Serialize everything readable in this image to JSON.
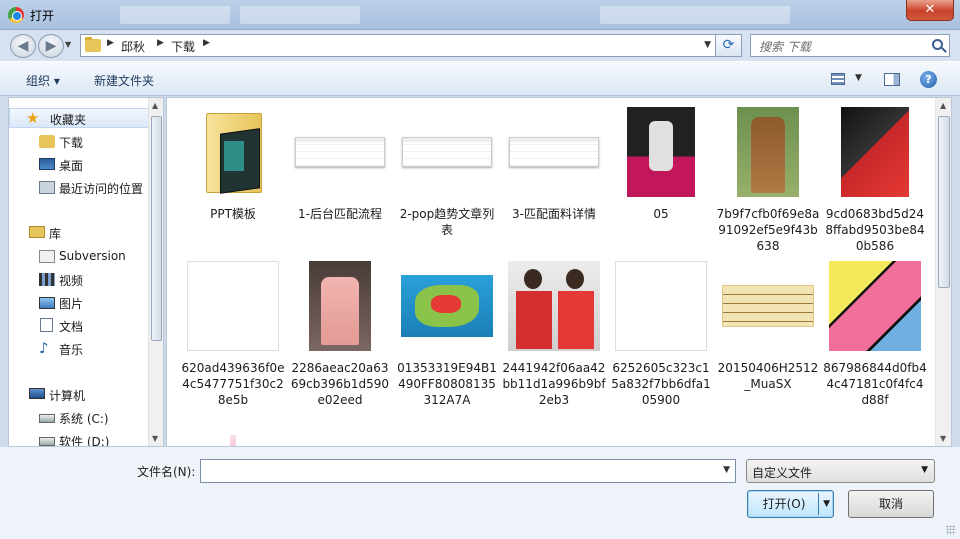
{
  "window": {
    "title": "打开",
    "close": "✕"
  },
  "address": {
    "crumbs": [
      "邱秋",
      "下载"
    ],
    "search_placeholder": "搜索 下载"
  },
  "toolbar": {
    "organize": "组织 ▾",
    "new_folder": "新建文件夹",
    "help": "?"
  },
  "nav": {
    "favorites": "收藏夹",
    "downloads": "下载",
    "desktop": "桌面",
    "recent": "最近访问的位置",
    "libraries": "库",
    "subversion": "Subversion",
    "videos": "视频",
    "pictures": "图片",
    "documents": "文档",
    "music": "音乐",
    "computer": "计算机",
    "drive_c": "系统 (C:)",
    "drive_d": "软件 (D:)"
  },
  "files": [
    {
      "name": "PPT模板",
      "kind": "folder"
    },
    {
      "name": "1-后台匹配流程",
      "kind": "screenshot"
    },
    {
      "name": "2-pop趋势文章列表",
      "kind": "screenshot"
    },
    {
      "name": "3-匹配面料详情",
      "kind": "screenshot"
    },
    {
      "name": "05",
      "kind": "photo-runway"
    },
    {
      "name": "7b9f7cfb0f69e8a91092ef5e9f43b638",
      "kind": "photo-fur"
    },
    {
      "name": "9cd0683bd5d248ffabd9503be840b586",
      "kind": "photo-red"
    },
    {
      "name": "620ad439636f0e4c5477751f30c28e5b",
      "kind": "pattern-birds"
    },
    {
      "name": "2286aeac20a6369cb396b1d590e02eed",
      "kind": "photo-pink-coat"
    },
    {
      "name": "01353319E94B1490FF80808135312A7A",
      "kind": "map"
    },
    {
      "name": "2441942f06aa42bb11d1a996b9bf2eb3",
      "kind": "photo-couple"
    },
    {
      "name": "6252605c323c15a832f7bb6dfa105900",
      "kind": "pattern-flowers"
    },
    {
      "name": "20150406H2512_MuaSX",
      "kind": "calligraphy"
    },
    {
      "name": "867986844d0fb44c47181c0f4fc4d88f",
      "kind": "color-blocks"
    },
    {
      "name": "",
      "kind": "partial-1"
    },
    {
      "name": "",
      "kind": "partial-2"
    },
    {
      "name": "",
      "kind": "partial-3"
    },
    {
      "name": "",
      "kind": "partial-4"
    }
  ],
  "bottom": {
    "filename_label": "文件名(N):",
    "filename_value": "",
    "filetype": "自定义文件",
    "open": "打开(O)",
    "cancel": "取消"
  },
  "colors": {
    "accent": "#3c7fb1",
    "titlebar": "#bcd0e8",
    "close": "#c7432a",
    "folder": "#e8c55a"
  }
}
